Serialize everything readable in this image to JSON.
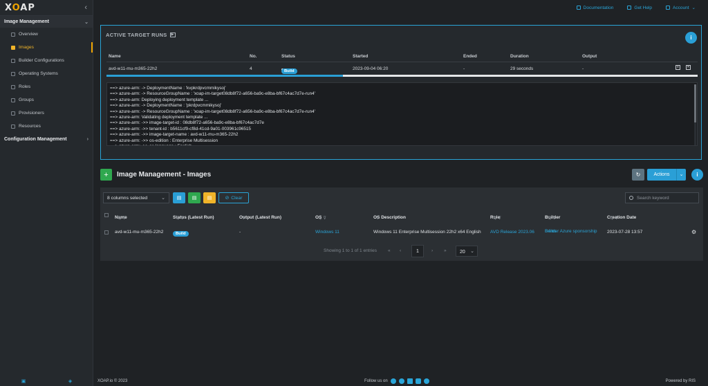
{
  "app": {
    "logo": "XOAP",
    "logo_accent": "O"
  },
  "sidebar": {
    "section_image": "Image Management",
    "items": [
      {
        "label": "Overview"
      },
      {
        "label": "Images"
      },
      {
        "label": "Builder Configurations"
      },
      {
        "label": "Operating Systems"
      },
      {
        "label": "Roles"
      },
      {
        "label": "Groups"
      },
      {
        "label": "Provisioners"
      },
      {
        "label": "Resources"
      }
    ],
    "section_config": "Configuration Management",
    "active_index": 1
  },
  "topbar": {
    "documentation": "Documentation",
    "get_help": "Get Help",
    "account": "Account"
  },
  "active_runs": {
    "title": "ACTIVE TARGET RUNS",
    "columns": [
      "Name",
      "No.",
      "Status",
      "Started",
      "Ended",
      "Duration",
      "Output"
    ],
    "row": {
      "name": "avd-w11-mu-m365-22h2",
      "no": "4",
      "status": "Build",
      "started": "2023-09-04 06:20",
      "ended": "-",
      "duration": "29 seconds",
      "output": "-"
    },
    "progress": 0.4,
    "console": [
      "==> azure-arm:  -> DeploymentName    : 'kvpkrdpvcmmikysoj'",
      "==> azure-arm:  -> ResourceGroupName : 'xoap-im-target08db8f72-a656-ba9c-e8ba-bf67c4ac7d7e-run4'",
      "==> azure-arm: Deploying deployment template ...",
      "==> azure-arm:  -> DeploymentName    : 'pkrdpvcmmikysoj'",
      "==> azure-arm:  -> ResourceGroupName : 'xoap-im-target08db8f72-a656-ba9c-e8ba-bf67c4ac7d7e-run4'",
      "==> azure-arm: Validating deployment template ...",
      "==> azure-arm:  ->> image-target-id : 08db8f72-a656-ba9c-e8ba-bf67c4ac7d7e",
      "==> azure-arm:  ->> tenant-id : b5611cf9-cf8d-41cd-9a01-003961c96515",
      "==> azure-arm:  ->> image-target-name : avd-w11-mu-m365-22h2",
      "==> azure-arm:  ->> os-edition : Enterprise Multisession",
      "==> azure-arm:  ->> os-language : English"
    ]
  },
  "images": {
    "title": "Image Management - Images",
    "actions_label": "Actions",
    "columns_selected": "8 columns selected",
    "clear_label": "Clear",
    "search_placeholder": "Search keyword",
    "columns": [
      "Name",
      "Status (Latest Run)",
      "Output (Latest Run)",
      "OS",
      "OS Description",
      "Role",
      "Builder",
      "Creation Date"
    ],
    "row": {
      "name": "avd-w11-mu-m365-22h2",
      "status": "Build",
      "output": "-",
      "os": "Windows 11",
      "os_description": "Windows 11 Enterprise Multisession 22h2 x64 English",
      "role": "AVD Release 2023.06",
      "builder_line1": "Builder Azure sponsorship",
      "builder_line2": "B4ms",
      "creation_date": "2023-07-28 13:57"
    },
    "pagination": {
      "summary": "Showing 1 to 1 of 1 entries",
      "first": "«",
      "prev": "‹",
      "current": "1",
      "next": "›",
      "last": "»",
      "page_size": "20"
    }
  },
  "footer": {
    "copyright": "XOAP.io © 2023",
    "follow": "Follow us on",
    "powered": "Powered by RIS"
  },
  "colors": {
    "accent": "#2a9fd6",
    "active_nav": "#f0b429",
    "add_green": "#2fa84f"
  }
}
